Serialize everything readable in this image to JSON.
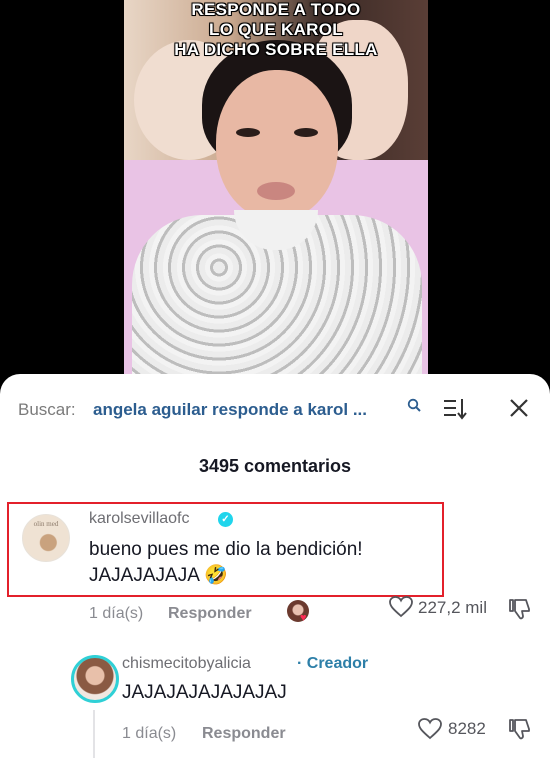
{
  "video": {
    "caption_lines": [
      "RESPONDE A TODO",
      "LO QUE KAROL",
      "HA DICHO SOBRE ELLA"
    ]
  },
  "search": {
    "label": "Buscar:",
    "query": "angela aguilar responde a karol ..."
  },
  "comments_count": "3495 comentarios",
  "comments": [
    {
      "username": "karolsevillaofc",
      "verified": true,
      "avatar_text": "olin med",
      "text_line1": "bueno pues me dio la bendición!",
      "text_line2": "JAJAJAJAJA 🤣",
      "date": "1 día(s)",
      "reply_label": "Responder",
      "likes": "227,2 mil"
    },
    {
      "username": "chismecitobyalicia",
      "badge": "· Creador",
      "text": "JAJAJAJAJAJAJAJ",
      "date": "1 día(s)",
      "reply_label": "Responder",
      "likes": "8282"
    }
  ],
  "colors": {
    "highlight_border": "#e3202b",
    "search_query": "#2c5d8f",
    "verified": "#20d5ec",
    "creator": "#2d7fa8"
  }
}
